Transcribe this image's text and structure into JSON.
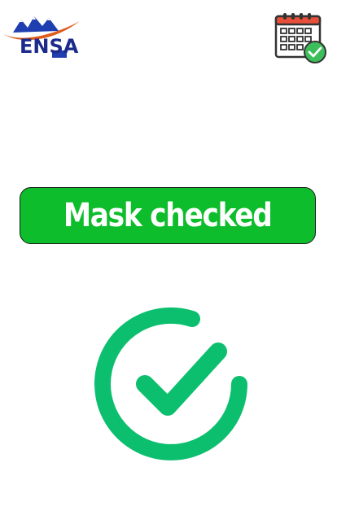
{
  "logo": {
    "text": "ENSA",
    "icon": "ensa-logo-mountains-icon"
  },
  "calendar": {
    "icon": "calendar-check-icon"
  },
  "status": {
    "label": "Mask checked",
    "background_color": "#0dbd2b",
    "text_color": "#ffffff"
  },
  "result_icon": {
    "icon": "circle-check-icon",
    "color": "#0cbf6e"
  }
}
